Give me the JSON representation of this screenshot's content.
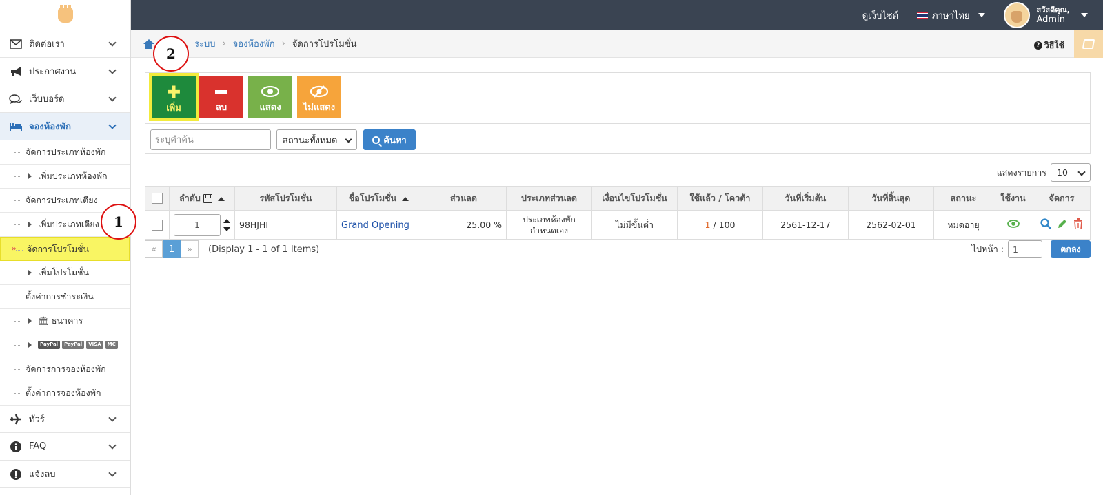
{
  "header": {
    "view_site": "ดูเว็บไซต์",
    "language": "ภาษาไทย",
    "greeting": "สวัสดีคุณ,",
    "user_name": "Admin"
  },
  "sidebar": {
    "items": [
      {
        "label": "ติดต่อเรา",
        "icon": "envelope-icon"
      },
      {
        "label": "ประกาศงาน",
        "icon": "megaphone-icon"
      },
      {
        "label": "เว็บบอร์ด",
        "icon": "comments-icon"
      },
      {
        "label": "จองห้องพัก",
        "icon": "bed-icon"
      },
      {
        "label": "ทัวร์",
        "icon": "plane-icon"
      },
      {
        "label": "FAQ",
        "icon": "info-icon"
      },
      {
        "label": "แจ้งลบ",
        "icon": "exclamation-icon"
      }
    ],
    "sub": {
      "room_types": "จัดการประเภทห้องพัก",
      "add_room_type": "เพิ่มประเภทห้องพัก",
      "bed_types": "จัดการประเภทเตียง",
      "add_bed_type": "เพิ่มประเภทเตียง",
      "promotions": "จัดการโปรโมชั่น",
      "add_promotion": "เพิ่มโปรโมชั่น",
      "payment_settings": "ตั้งค่าการชำระเงิน",
      "bank": "ธนาคาร",
      "pay_badges": [
        "PayPal",
        "VISA",
        "MC"
      ],
      "bookings": "จัดการการจองห้องพัก",
      "booking_settings": "ตั้งค่าการจองห้องพัก"
    }
  },
  "breadcrumb": {
    "home": "ระบบ",
    "section": "จองห้องพัก",
    "current": "จัดการโปรโมชั่น",
    "help": "วิธีใช้"
  },
  "annotations": {
    "mark1": "1",
    "mark2": "2"
  },
  "toolbar": {
    "add": "เพิ่ม",
    "delete": "ลบ",
    "show": "แสดง",
    "hide": "ไม่แสดง",
    "search_placeholder": "ระบุคำค้น",
    "status_select": "สถานะทั้งหมด",
    "search_button": "ค้นหา"
  },
  "list": {
    "per_page_label": "แสดงรายการ",
    "per_page_value": "10",
    "columns": [
      "ลำดับ",
      "รหัสโปรโมชั่น",
      "ชื่อโปรโมชั่น",
      "ส่วนลด",
      "ประเภทส่วนลด",
      "เงื่อนไขโปรโมชั่น",
      "ใช้แล้ว / โควต้า",
      "วันที่เริ่มต้น",
      "วันที่สิ้นสุด",
      "สถานะ",
      "ใช้งาน",
      "จัดการ"
    ],
    "rows": [
      {
        "order": "1",
        "code": "98HJHI",
        "name": "Grand Opening",
        "discount": "25.00 %",
        "discount_type": "ประเภทห้องพักกำหนดเอง",
        "condition": "ไม่มีขั้นต่ำ",
        "used": "1",
        "quota": "/ 100",
        "start": "2561-12-17",
        "end": "2562-02-01",
        "status": "หมดอายุ"
      }
    ]
  },
  "pagination": {
    "prev": "«",
    "current": "1",
    "next": "»",
    "info": "(Display 1 - 1 of 1 Items)",
    "goto_label": "ไปหน้า :",
    "goto_value": "1",
    "goto_button": "ตกลง"
  },
  "colors": {
    "add": "#1e8a3c",
    "delete": "#d9322d",
    "show": "#78b14a",
    "hide": "#f6a43b",
    "primary": "#3b82c9"
  }
}
